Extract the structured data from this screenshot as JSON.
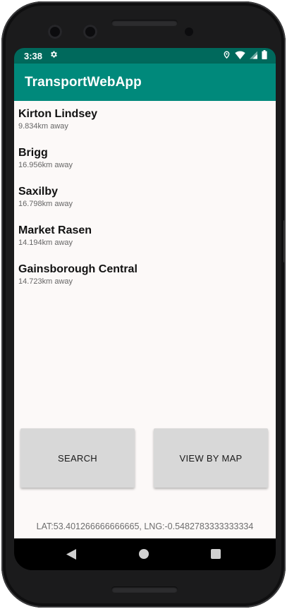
{
  "status_bar": {
    "time": "3:38",
    "icons": [
      "settings-gear-icon",
      "location-icon",
      "wifi-icon",
      "signal-icon",
      "battery-icon"
    ]
  },
  "app_bar": {
    "title": "TransportWebApp"
  },
  "stations": [
    {
      "name": "Kirton Lindsey",
      "distance": "9.834km away"
    },
    {
      "name": "Brigg",
      "distance": "16.956km away"
    },
    {
      "name": "Saxilby",
      "distance": "16.798km away"
    },
    {
      "name": "Market Rasen",
      "distance": "14.194km away"
    },
    {
      "name": "Gainsborough Central",
      "distance": "14.723km away"
    }
  ],
  "buttons": {
    "search": "SEARCH",
    "view_by_map": "VIEW BY MAP"
  },
  "location_readout": "LAT:53.401266666666665, LNG:-0.5482783333333334",
  "colors": {
    "status_bar": "#00695c",
    "app_bar": "#00897b",
    "content_bg": "#fcf9f8",
    "button_bg": "#d8d8d8"
  }
}
